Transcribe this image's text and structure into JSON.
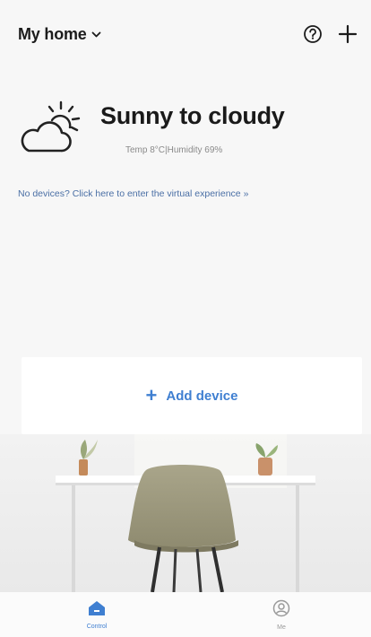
{
  "header": {
    "home_title": "My home",
    "icons": [
      "chevron-down-icon",
      "help-icon",
      "add-icon"
    ]
  },
  "weather": {
    "condition": "Sunny to cloudy",
    "details": "Temp 8°C|Humidity 69%",
    "icon": "partly-sunny-icon"
  },
  "hint": {
    "text": "No devices? Click here to enter the virtual experience",
    "arrow": "»"
  },
  "add_device": {
    "plus": "+",
    "label": "Add device"
  },
  "bottom_nav": {
    "items": [
      {
        "label": "Control",
        "icon": "home-icon",
        "active": true
      },
      {
        "label": "Me",
        "icon": "profile-icon",
        "active": false
      }
    ]
  },
  "colors": {
    "accent": "#3f7fd1",
    "background": "#f7f7f7",
    "card": "#ffffff"
  }
}
